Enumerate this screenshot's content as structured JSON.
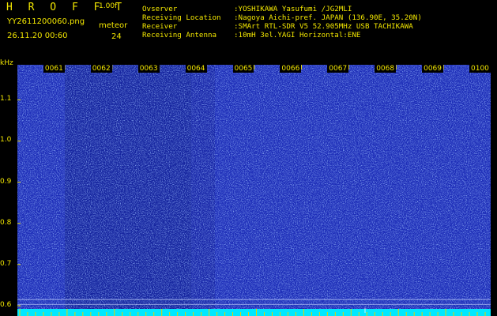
{
  "header": {
    "app_title": "H R O F F T",
    "version": "1.00f",
    "filename": "YY2611200060.png",
    "datetime": "26.11.20 00:60",
    "meteor_label": "meteor",
    "meteor_count": "24"
  },
  "info": [
    {
      "key": "Ovserver",
      "value": ":YOSHIKAWA Yasufumi /JG2MLI"
    },
    {
      "key": "Receiving Location",
      "value": ":Nagoya Aichi-pref. JAPAN (136.90E, 35.20N)"
    },
    {
      "key": "Receiver",
      "value": ":SMArt RTL-SDR V5 52.905MHz USB TACHIKAWA"
    },
    {
      "key": "Receiving Antenna",
      "value": ":10mH 3el.YAGI Horizontal:ENE"
    }
  ],
  "axis": {
    "unit": "kHz",
    "y_ticks": [
      "1.1",
      "1.0",
      "0.9",
      "0.8",
      "0.7",
      "0.6"
    ],
    "y_values": [
      1.1,
      1.0,
      0.9,
      0.8,
      0.7,
      0.6
    ],
    "y_range": [
      0.575,
      1.185
    ],
    "time_ticks": [
      "0061",
      "0062",
      "0063",
      "0064",
      "0065",
      "0066",
      "0067",
      "0068",
      "0069",
      "0100"
    ]
  },
  "colors": {
    "label": "#f2e600",
    "background": "#1e2eb8",
    "noise": "#4a78ff",
    "baseline": "#00e8ff"
  }
}
